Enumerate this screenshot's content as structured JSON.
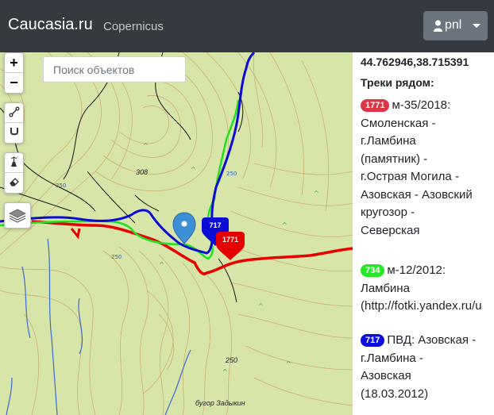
{
  "navbar": {
    "brand": "Caucasia.ru",
    "link": "Copernicus",
    "user_label": "pnl"
  },
  "map": {
    "search_placeholder": "Поиск объектов",
    "zoom_in": "+",
    "zoom_out": "−",
    "labels": {
      "height_308": "308",
      "height_250": "250",
      "bugor": "бугор Задыкин"
    },
    "markers": {
      "blue_track": "717",
      "red_track": "1771"
    },
    "colors": {
      "terrain": "#d7e5a8",
      "contour": "#c9a56b",
      "river": "#3a6bd1",
      "track_red": "#e60000",
      "track_green": "#1fe11f",
      "track_blue": "#0b0bd6",
      "pin": "#3d8fd6"
    }
  },
  "panel": {
    "coords": "44.762946,38.715391",
    "tracks_title": "Треки рядом:",
    "tracks": [
      {
        "id": "1771",
        "color": "red",
        "lines": [
          "м-35/2018:",
          "Смоленская -",
          "г.Ламбина",
          "(памятник) -",
          "г.Острая Могила -",
          "Азовская - Азовский",
          "кругозор -",
          "Северская"
        ]
      },
      {
        "id": "734",
        "color": "green",
        "lines": [
          "м-12/2012:",
          "Ламбина",
          "(http://fotki.yandex.ru/u"
        ]
      },
      {
        "id": "717",
        "color": "blue",
        "lines": [
          "ПВД: Азовская -",
          "г.Ламбина -",
          "Азовская",
          "(18.03.2012)"
        ]
      }
    ]
  }
}
